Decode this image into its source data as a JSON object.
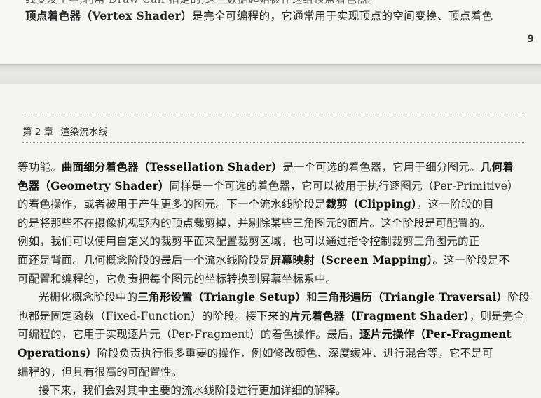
{
  "top_page": {
    "cut_line": "线变发生中,利用 Draw Call 指定的,这些数据起始被作送给顶点着色器。",
    "line_segments": [
      {
        "t": "顶点着色器（Vertex Shader）",
        "b": true
      },
      {
        "t": "是完全可编程的，它通常用于实现顶点的空间变换、顶点着色",
        "b": false
      }
    ],
    "page_number": "9"
  },
  "chapter": {
    "number": "第 2 章",
    "title": "渲染流水线"
  },
  "paragraphs": [
    {
      "indent": false,
      "lines": [
        [
          {
            "t": "等功能。",
            "b": false
          },
          {
            "t": "曲面细分着色器（Tessellation Shader）",
            "b": true
          },
          {
            "t": "是一个可选的着色器，它用于细分图元。",
            "b": false
          },
          {
            "t": "几何着",
            "b": true
          }
        ],
        [
          {
            "t": "色器（Geometry Shader）",
            "b": true
          },
          {
            "t": "同样是一个可选的着色器，它可以被用于执行逐图元（Per-Primitive）",
            "b": false
          }
        ],
        [
          {
            "t": "的着色操作，或者被用于产生更多的图元。下一个流水线阶段是",
            "b": false
          },
          {
            "t": "裁剪（Clipping）",
            "b": true
          },
          {
            "t": "，这一阶段的目",
            "b": false
          }
        ],
        [
          {
            "t": "的是将那些不在摄像机视野内的顶点裁剪掉，并剔除某些三角图元的面片。这个阶段是可配置的。",
            "b": false
          }
        ],
        [
          {
            "t": "例如，我们可以使用自定义的裁剪平面来配置裁剪区域，也可以通过指令控制裁剪三角图元的正",
            "b": false
          }
        ],
        [
          {
            "t": "面还是背面。几何概念阶段的最后一个流水线阶段是",
            "b": false
          },
          {
            "t": "屏幕映射（Screen Mapping）",
            "b": true
          },
          {
            "t": "。这一阶段是不",
            "b": false
          }
        ],
        [
          {
            "t": "可配置和编程的，它负责把每个图元的坐标转换到屏幕坐标系中。",
            "b": false
          }
        ]
      ]
    },
    {
      "indent": true,
      "lines": [
        [
          {
            "t": "光栅化概念阶段中的",
            "b": false
          },
          {
            "t": "三角形设置（Triangle Setup）",
            "b": true
          },
          {
            "t": "和",
            "b": false
          },
          {
            "t": "三角形遍历（Triangle Traversal）",
            "b": true
          },
          {
            "t": "阶段",
            "b": false
          }
        ],
        [
          {
            "t": "也都是固定函数（Fixed-Function）的阶段。接下来的",
            "b": false
          },
          {
            "t": "片元着色器（Fragment Shader）",
            "b": true
          },
          {
            "t": "，则是完全",
            "b": false
          }
        ],
        [
          {
            "t": "可编程的，它用于实现逐片元（Per-Fragment）的着色操作。最后，",
            "b": false
          },
          {
            "t": "逐片元操作（Per-Fragment",
            "b": true
          }
        ],
        [
          {
            "t": "Operations）",
            "b": true
          },
          {
            "t": "阶段负责执行很多重要的操作，例如修改颜色、深度缓冲、进行混合等，它不是可",
            "b": false
          }
        ],
        [
          {
            "t": "编程的，但具有很高的可配置性。",
            "b": false
          }
        ]
      ]
    },
    {
      "indent": true,
      "lines": [
        [
          {
            "t": "接下来，我们会对其中主要的流水线阶段进行更加详细的解释。",
            "b": false
          }
        ]
      ]
    }
  ]
}
